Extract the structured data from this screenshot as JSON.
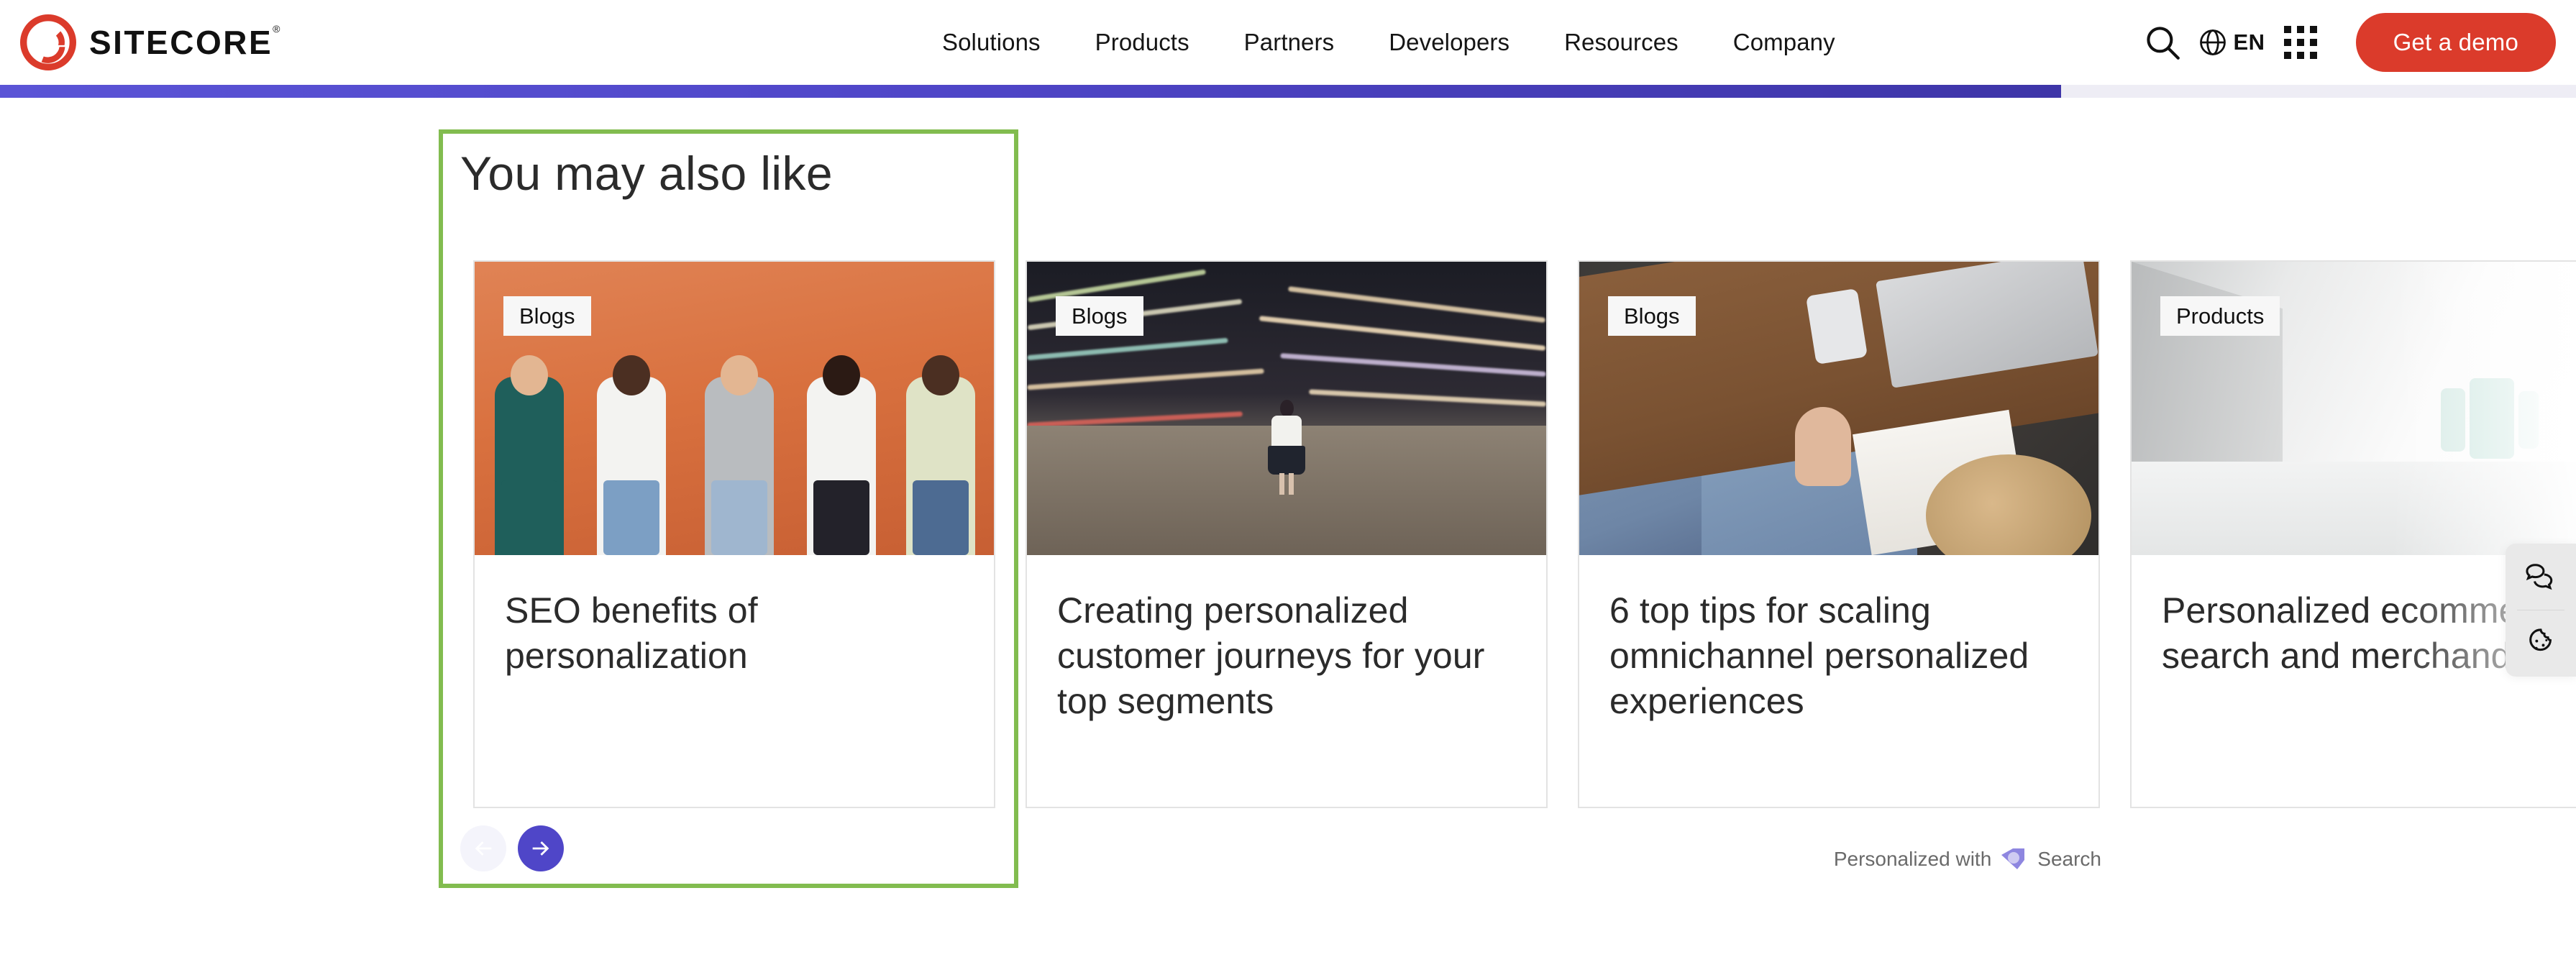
{
  "header": {
    "brand_name": "SITECORE",
    "brand_trademark": "®",
    "logo_icon": "sitecore-logo-icon",
    "nav_items": [
      {
        "label": "Solutions"
      },
      {
        "label": "Products"
      },
      {
        "label": "Partners"
      },
      {
        "label": "Developers"
      },
      {
        "label": "Resources"
      },
      {
        "label": "Company"
      }
    ],
    "search_icon": "search-icon",
    "language": {
      "icon": "globe-icon",
      "label": "EN"
    },
    "apps_icon": "grid-apps-icon",
    "cta_label": "Get a demo",
    "cta_color": "#DB3B2B"
  },
  "scroll_progress": {
    "percent": 80,
    "fill_color": "#4F46C8",
    "track_color": "#EEEDF5"
  },
  "widget": {
    "title": "You may also like",
    "highlight_border_color": "#82BC4F",
    "cards": [
      {
        "badge": "Blogs",
        "title": "SEO benefits of personalization",
        "image_alt": "group-of-people-on-phones-orange-wall"
      },
      {
        "badge": "Blogs",
        "title": "Creating personalized customer journeys for your top segments",
        "image_alt": "woman-standing-night-city-light-trails"
      },
      {
        "badge": "Blogs",
        "title": "6 top tips for scaling omnichannel personalized experiences",
        "image_alt": "people-at-desk-with-laptop-overhead"
      },
      {
        "badge": "Products",
        "title": "Personalized ecommerce search and merchandising",
        "image_alt": "white-product-room-abstract"
      }
    ],
    "controls": {
      "prev_label": "Previous",
      "next_label": "Next",
      "prev_icon": "arrow-left-icon",
      "next_icon": "arrow-right-icon",
      "prev_disabled": true,
      "next_color": "#4F46C8"
    },
    "attribution": {
      "prefix": "Personalized with",
      "brand": "Search",
      "logo_icon": "sitecore-search-logo-icon",
      "accent_color": "#8E86E0"
    }
  },
  "side_widgets": [
    {
      "icon": "chat-bubbles-icon",
      "name": "live-chat"
    },
    {
      "icon": "cookie-icon",
      "name": "cookie-preferences"
    }
  ]
}
